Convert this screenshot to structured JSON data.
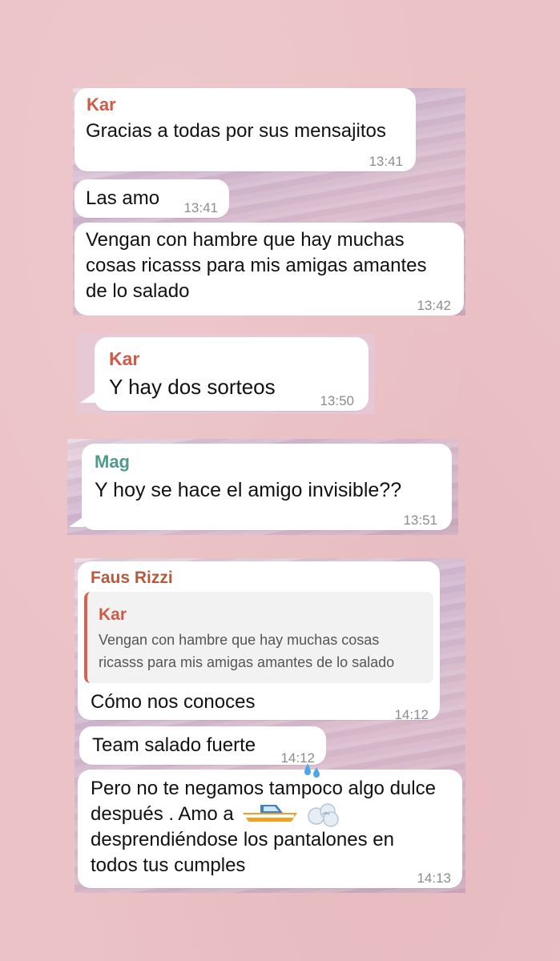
{
  "block1": {
    "sender": "Kar",
    "messages": [
      {
        "text": "Gracias a todas por sus mensajitos",
        "time": "13:41"
      },
      {
        "text": "Las amo",
        "time": "13:41"
      },
      {
        "text_lines": [
          "Vengan con hambre que hay muchas",
          "cosas ricasss para mis amigas amantes",
          "de lo salado"
        ],
        "time": "13:42"
      }
    ]
  },
  "block2": {
    "sender": "Kar",
    "message": {
      "text": "Y hay dos sorteos",
      "time": "13:50"
    }
  },
  "block3": {
    "sender": "Mag",
    "message": {
      "text": "Y hoy se hace el amigo invisible??",
      "time": "13:51"
    }
  },
  "block4": {
    "sender": "Faus Rizzi",
    "reply": {
      "sender": "Kar",
      "text_lines": [
        "Vengan con hambre que hay muchas cosas",
        "ricasss para mis amigas amantes de lo salado"
      ]
    },
    "messages": [
      {
        "text": "Cómo nos conoces",
        "time": "14:12"
      },
      {
        "text": "Team salado fuerte",
        "time": "14:12"
      },
      {
        "text_lines": [
          "Pero no te negamos tampoco algo dulce",
          "después . Amo a",
          "desprendiéndose los pantalones en",
          "todos tus cumples"
        ],
        "time": "14:13"
      }
    ],
    "emojis": [
      "droplets-emoji",
      "speedboat-emoji",
      "dash-emoji"
    ]
  },
  "colors": {
    "page_bg": "#ebc2c6",
    "bubble": "#ffffff",
    "sender_kar": "#cf5a45",
    "sender_mag": "#4f9a8d",
    "sender_faus": "#b55a3c",
    "timestamp": "#8c8c8c"
  }
}
